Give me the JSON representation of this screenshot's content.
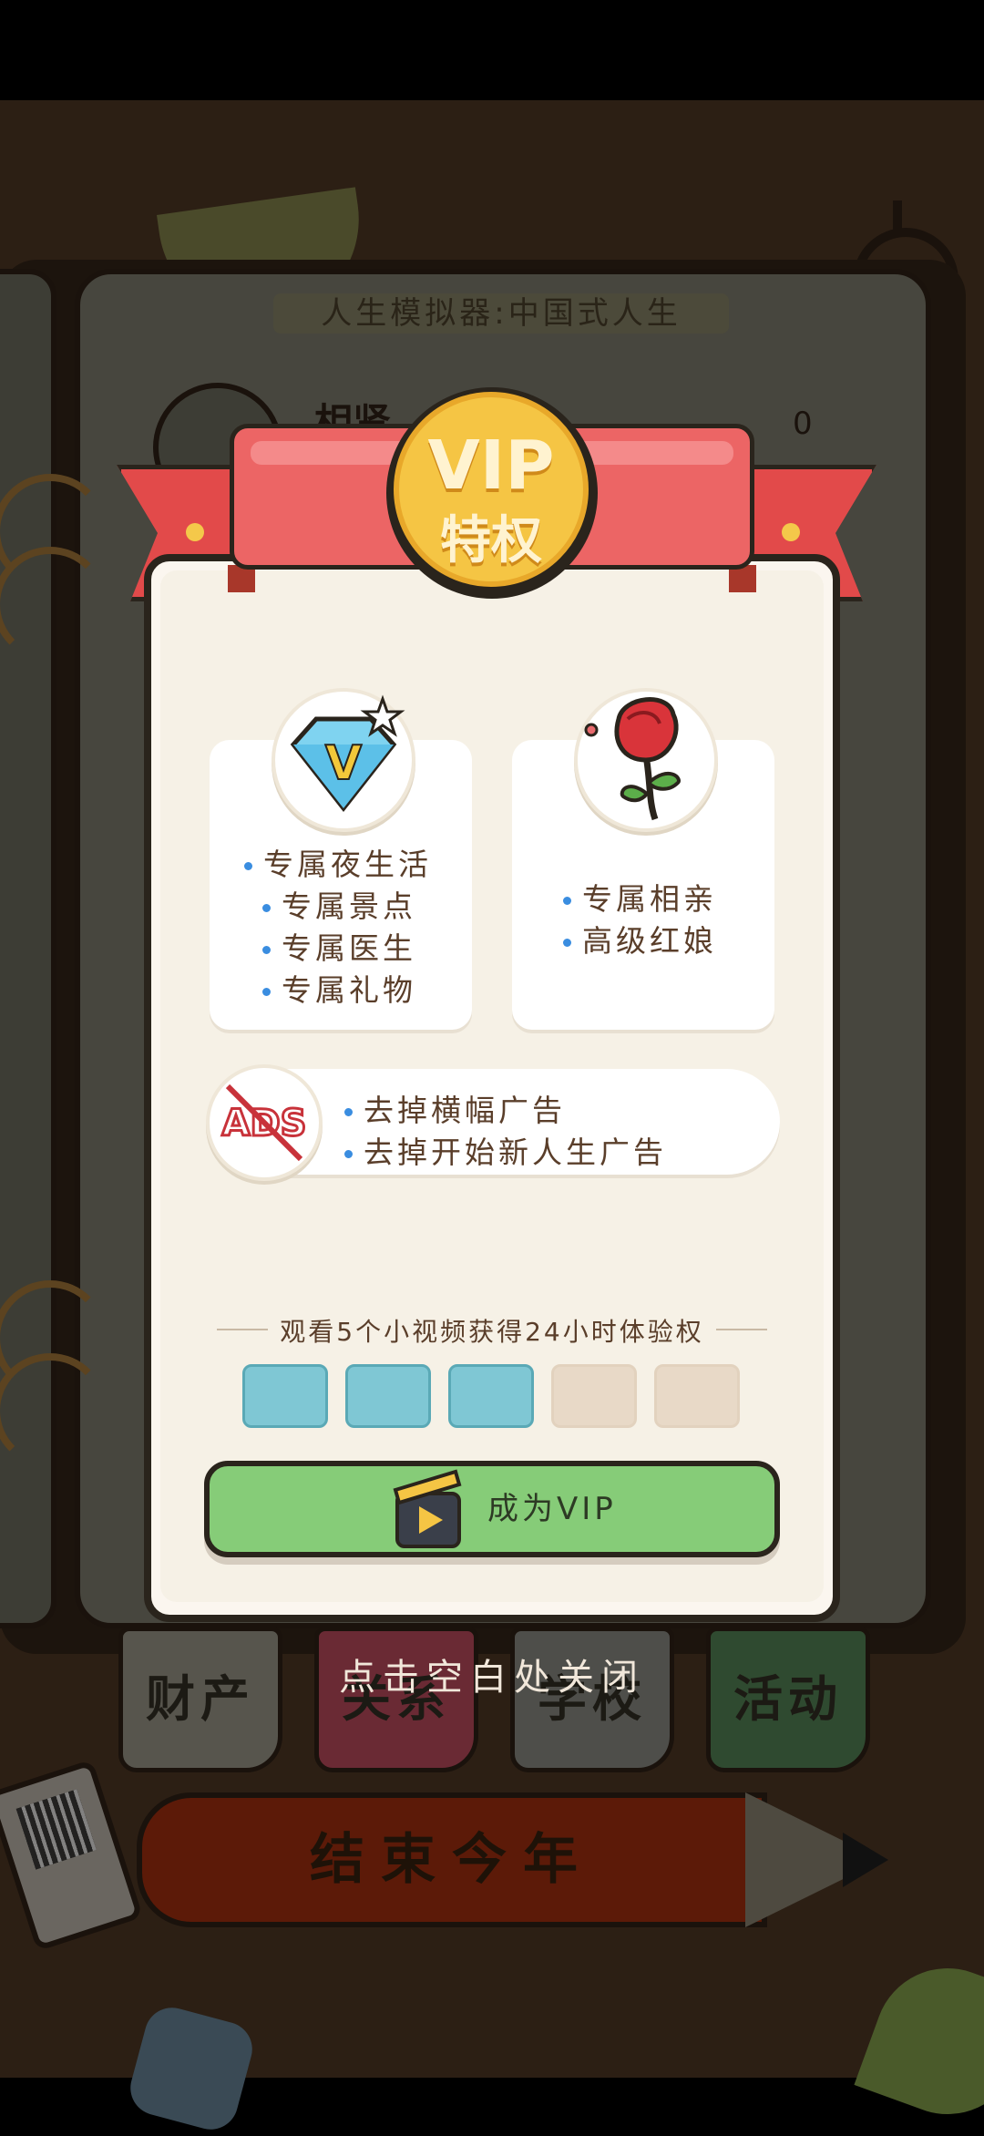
{
  "background": {
    "book_title": "人生模拟器:中国式人生",
    "profile_name": "相肾",
    "money_value": "0",
    "tabs": [
      {
        "label": "财产",
        "color": "#57554d"
      },
      {
        "label": "关系",
        "color": "#6a2a34"
      },
      {
        "label": "学校",
        "color": "#4e4e4a"
      },
      {
        "label": "活动",
        "color": "#2f4a30"
      }
    ],
    "end_year_button": "结束今年"
  },
  "dialog": {
    "medal_line1": "VIP",
    "medal_line2": "特权",
    "card_left": {
      "icon": "diamond-v-icon",
      "items": [
        "专属夜生活",
        "专属景点",
        "专属医生",
        "专属礼物"
      ]
    },
    "card_right": {
      "icon": "rose-icon",
      "items": [
        "专属相亲",
        "高级红娘"
      ]
    },
    "ads": {
      "icon": "no-ads-icon",
      "icon_text": "ADS",
      "items": [
        "去掉横幅广告",
        "去掉开始新人生广告"
      ]
    },
    "progress_hint": "观看5个小视频获得24小时体验权",
    "progress": {
      "completed": 3,
      "total": 5
    },
    "vip_button_label": "成为VIP"
  },
  "close_hint": "点击空白处关闭",
  "colors": {
    "ribbon": "#ec6565",
    "medal": "#f5c544",
    "button": "#86cc78",
    "progress_done": "#7fc7d4",
    "progress_todo": "#e8d9c7",
    "bullet": "#3a8de0"
  }
}
